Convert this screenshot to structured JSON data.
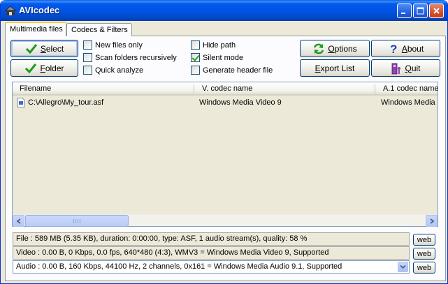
{
  "window": {
    "title": "AVIcodec",
    "controls": {
      "minimize_icon": "minimize-icon",
      "maximize_icon": "maximize-icon",
      "close_icon": "close-icon"
    }
  },
  "tabs": [
    {
      "label": "Multimedia files",
      "active": true
    },
    {
      "label": "Codecs & Filters",
      "active": false
    }
  ],
  "buttons": {
    "select": {
      "label": "Select",
      "accel": "S",
      "icon": "green-check-icon"
    },
    "folder": {
      "label": "Folder",
      "accel": "F",
      "icon": "green-check-icon"
    },
    "options": {
      "label": "Options",
      "accel": "O",
      "icon": "refresh-icon"
    },
    "about": {
      "label": "About",
      "accel": "A",
      "icon": "question-icon"
    },
    "export_list": {
      "label": "Export List",
      "accel": "E"
    },
    "quit": {
      "label": "Quit",
      "accel": "Q",
      "icon": "quit-icon"
    }
  },
  "checkboxes": [
    {
      "label": "New files only",
      "checked": false
    },
    {
      "label": "Scan folders recursively",
      "checked": false
    },
    {
      "label": "Quick analyze",
      "checked": false
    },
    {
      "label": "Hide path",
      "checked": false
    },
    {
      "label": "Silent mode",
      "checked": true
    },
    {
      "label": "Generate header file",
      "checked": false
    }
  ],
  "file_list": {
    "columns": [
      "Filename",
      "V. codec name",
      "A.1 codec name"
    ],
    "rows": [
      {
        "filename": "C:\\Allegro\\My_tour.asf",
        "video_codec": "Windows Media Video 9",
        "audio_codec": "Windows Media"
      }
    ]
  },
  "info": {
    "file": "File    :  589 MB (5.35 KB),  duration: 0:00:00,  type: ASF,  1 audio stream(s),  quality: 58 %",
    "video": "Video :  0.00 B,  0 Kbps,  0.0 fps,  640*480 (4:3),  WMV3 = Windows Media Video 9,   Supported",
    "audio": "Audio :  0.00 B,  160 Kbps,  44100 Hz,  2 channels,  0x161 = Windows Media Audio 9.1,   Supported",
    "web_label": "web"
  },
  "colors": {
    "titlebar": "#0054E3",
    "face": "#ECE9D8",
    "check_green": "#21A121"
  }
}
